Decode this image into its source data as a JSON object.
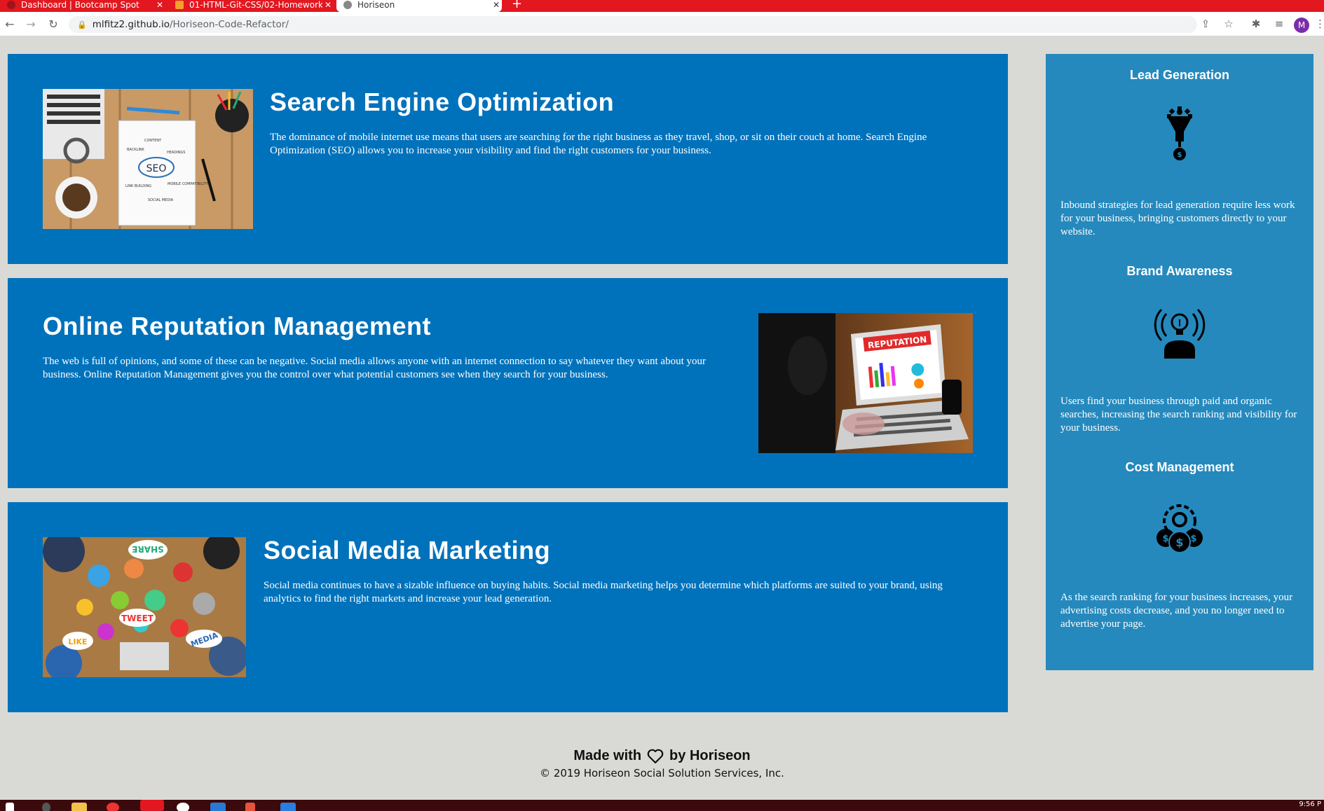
{
  "browser": {
    "tabs": [
      {
        "title": "Dashboard | Bootcamp Spot"
      },
      {
        "title": "01-HTML-Git-CSS/02-Homework"
      },
      {
        "title": "Horiseon"
      }
    ],
    "url_host": "mlfitz2.github.io",
    "url_path": "/Horiseon-Code-Refactor/",
    "avatar_initial": "M"
  },
  "cards": [
    {
      "title": "Search Engine Optimization",
      "text": "The dominance of mobile internet use means that users are searching for the right business as they travel, shop, or sit on their couch at home. Search Engine Optimization (SEO) allows you to increase your visibility and find the right customers for your business.",
      "image_words": [
        "CONTENT",
        "BACKLINK",
        "HEADINGS",
        "SEO",
        "LINK BUILDING",
        "MOBILE COMPATIBILITY",
        "SOCIAL MEDIA"
      ]
    },
    {
      "title": "Online Reputation Management",
      "text": "The web is full of opinions, and some of these can be negative. Social media allows anyone with an internet connection to say whatever they want about your business. Online Reputation Management gives you the control over what potential customers see when they search for your business.",
      "image_words": [
        "REPUTATION"
      ]
    },
    {
      "title": "Social Media Marketing",
      "text": "Social media continues to have a sizable influence on buying habits. Social media marketing helps you determine which platforms are suited to your brand, using analytics to find the right markets and increase your lead generation.",
      "image_words": [
        "SHARE",
        "TWEET",
        "LIKE",
        "MEDIA"
      ]
    }
  ],
  "benefits": [
    {
      "title": "Lead Generation",
      "icon": "lead-generation-icon",
      "text": "Inbound strategies for lead generation require less work for your business, bringing customers directly to your website."
    },
    {
      "title": "Brand Awareness",
      "icon": "brand-awareness-icon",
      "text": "Users find your business through paid and organic searches, increasing the search ranking and visibility for your business."
    },
    {
      "title": "Cost Management",
      "icon": "cost-management-icon",
      "text": "As the search ranking for your business increases, your advertising costs decrease, and you no longer need to advertise your page."
    }
  ],
  "footer": {
    "made_prefix": "Made with",
    "made_suffix": "by Horiseon",
    "copyright": "© 2019 Horiseon Social Solution Services, Inc."
  },
  "taskbar": {
    "clock": "9:56 P"
  },
  "colors": {
    "card_blue": "#0072bb",
    "sidebar_blue": "#2589bd",
    "page_bg": "#d9dad6",
    "tab_strip_red": "#e2171f"
  }
}
